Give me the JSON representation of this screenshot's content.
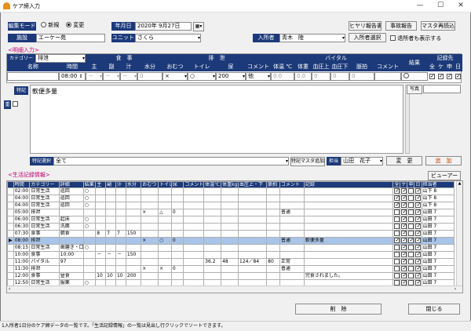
{
  "window": {
    "title": "ケア締入力",
    "min": "—",
    "max": "☐",
    "close": "✕"
  },
  "top": {
    "mode_label": "編集モード",
    "mode_new": "新規",
    "mode_edit": "変更",
    "date_label": "年月日",
    "date_value": "2020年 9月27日",
    "btn_hiyari": "ヒヤリ報告書",
    "btn_jiko": "事故報告",
    "btn_master": "マスタ再読込",
    "facility_label": "施設",
    "facility_value": "エーケー苑",
    "unit_label": "ユニット",
    "unit_value": "さくら",
    "resident_label": "入所者",
    "resident_value": "青木　陸",
    "btn_select": "入所者選択",
    "show_discharged": "退所者も表示する"
  },
  "detail": {
    "section_title": "<明細入力>",
    "category_label": "カテゴリー",
    "category_value": "排泄",
    "groups": {
      "meal": "食　事",
      "excretion": "排　泄",
      "vital": "バイタル",
      "result": "結果",
      "record": "記録先"
    },
    "cols": [
      "名称",
      "時間",
      "主",
      "副",
      "汁",
      "水分",
      "おむつ",
      "トイレ",
      "尿",
      "コメント",
      "体温 ℃",
      "体重",
      "血圧上",
      "血圧下",
      "脈拍",
      "コメント"
    ],
    "rec_cols": [
      "全",
      "ケ",
      "申",
      "日"
    ],
    "row": {
      "time": "08:00",
      "omutsu": "×",
      "toilet": "○",
      "urine": "200",
      "comment": "他",
      "temp": "0.0",
      "weight": "0.0",
      "bpu": "0",
      "bpl": "0",
      "pulse": "0"
    },
    "tokki_label": "特記",
    "tokki_text": "軟便多量",
    "photo_label": "写真",
    "priority_label": "重",
    "tokki_select_label": "特記選択",
    "tokki_select_value": "全て",
    "tokki_master": "特記マスタ追加",
    "tanto_label": "担当",
    "tanto_value": "山田　花子",
    "btn_change": "変　更",
    "btn_add": "追　加"
  },
  "life": {
    "section_title": "<生活記録情報>",
    "btn_viewer": "ビューアー",
    "headers": [
      "時間",
      "カテゴリー",
      "詳細",
      "結果",
      "主",
      "副",
      "汁",
      "水分",
      "おむつ",
      "トイレ",
      "尿",
      "コメント",
      "体温℃",
      "体重kg",
      "血圧上・下",
      "脈拍",
      "コメント",
      "記録",
      "全",
      "ケ",
      "申",
      "日",
      "担当者"
    ],
    "rows": [
      {
        "time": "02:00",
        "cat": "日常生活",
        "detail": "巡回",
        "res": "○",
        "main": "",
        "side": "",
        "soup": "",
        "water": "",
        "omutsu": "",
        "toilet": "",
        "urine": "",
        "cmt": "",
        "temp": "",
        "wt": "",
        "bp": "",
        "pulse": "",
        "cmt2": "",
        "rec": "",
        "c": [
          1,
          1,
          0,
          1
        ],
        "staff": "山下 8"
      },
      {
        "time": "04:00",
        "cat": "日常生活",
        "detail": "巡回",
        "res": "○",
        "main": "",
        "side": "",
        "soup": "",
        "water": "",
        "omutsu": "",
        "toilet": "",
        "urine": "",
        "cmt": "",
        "temp": "",
        "wt": "",
        "bp": "",
        "pulse": "",
        "cmt2": "",
        "rec": "",
        "c": [
          1,
          1,
          0,
          1
        ],
        "staff": "山下 8"
      },
      {
        "time": "04:00",
        "cat": "日常生活",
        "detail": "巡回",
        "res": "○",
        "main": "",
        "side": "",
        "soup": "",
        "water": "",
        "omutsu": "",
        "toilet": "",
        "urine": "",
        "cmt": "",
        "temp": "",
        "wt": "",
        "bp": "",
        "pulse": "",
        "cmt2": "",
        "rec": "",
        "c": [
          1,
          1,
          0,
          1
        ],
        "staff": "山下 8"
      },
      {
        "time": "05:00",
        "cat": "排泄",
        "detail": "",
        "res": "",
        "main": "",
        "side": "",
        "soup": "",
        "water": "",
        "omutsu": "×",
        "toilet": "△",
        "urine": "0",
        "cmt": "",
        "temp": "",
        "wt": "",
        "bp": "",
        "pulse": "",
        "cmt2": "普通",
        "rec": "",
        "c": [
          0,
          1,
          0,
          1
        ],
        "staff": "山田 7"
      },
      {
        "time": "06:00",
        "cat": "日常生活",
        "detail": "起床",
        "res": "○",
        "main": "",
        "side": "",
        "soup": "",
        "water": "",
        "omutsu": "",
        "toilet": "",
        "urine": "",
        "cmt": "",
        "temp": "",
        "wt": "",
        "bp": "",
        "pulse": "",
        "cmt2": "",
        "rec": "",
        "c": [
          0,
          1,
          0,
          1
        ],
        "staff": "山田 7"
      },
      {
        "time": "06:30",
        "cat": "日常生活",
        "detail": "洗面",
        "res": "○",
        "main": "",
        "side": "",
        "soup": "",
        "water": "",
        "omutsu": "",
        "toilet": "",
        "urine": "",
        "cmt": "",
        "temp": "",
        "wt": "",
        "bp": "",
        "pulse": "",
        "cmt2": "",
        "rec": "",
        "c": [
          0,
          1,
          0,
          1
        ],
        "staff": "山田 7"
      },
      {
        "time": "07:30",
        "cat": "食事",
        "detail": "朝食",
        "res": "",
        "main": "8",
        "side": "7",
        "soup": "7",
        "water": "150",
        "omutsu": "",
        "toilet": "",
        "urine": "",
        "cmt": "",
        "temp": "",
        "wt": "",
        "bp": "",
        "pulse": "",
        "cmt2": "",
        "rec": "",
        "c": [
          0,
          1,
          0,
          1
        ],
        "staff": "山田 7"
      },
      {
        "time": "08:00",
        "cat": "排泄",
        "detail": "",
        "res": "",
        "main": "",
        "side": "",
        "soup": "",
        "water": "",
        "omutsu": "×",
        "toilet": "○",
        "urine": "0",
        "cmt": "",
        "temp": "",
        "wt": "",
        "bp": "",
        "pulse": "",
        "cmt2": "普通",
        "rec": "軟便多量",
        "c": [
          1,
          1,
          1,
          1
        ],
        "staff": "山田 7",
        "sel": true
      },
      {
        "time": "08:15",
        "cat": "日常生活",
        "detail": "歯磨き・口",
        "res": "○",
        "main": "",
        "side": "",
        "soup": "",
        "water": "",
        "omutsu": "",
        "toilet": "",
        "urine": "",
        "cmt": "",
        "temp": "",
        "wt": "",
        "bp": "",
        "pulse": "",
        "cmt2": "",
        "rec": "",
        "c": [
          0,
          1,
          0,
          1
        ],
        "staff": "山田 7"
      },
      {
        "time": "10:00",
        "cat": "食事",
        "detail": "10:00",
        "res": "",
        "main": "－",
        "side": "－",
        "soup": "－",
        "water": "150",
        "omutsu": "",
        "toilet": "",
        "urine": "",
        "cmt": "",
        "temp": "",
        "wt": "",
        "bp": "",
        "pulse": "",
        "cmt2": "",
        "rec": "",
        "c": [
          0,
          1,
          0,
          1
        ],
        "staff": "山田 7"
      },
      {
        "time": "11:00",
        "cat": "バイタル",
        "detail": "97",
        "res": "",
        "main": "",
        "side": "",
        "soup": "",
        "water": "",
        "omutsu": "",
        "toilet": "",
        "urine": "",
        "cmt": "",
        "temp": "36.2",
        "wt": "48",
        "bp": "124／84",
        "pulse": "80",
        "cmt2": "正常",
        "rec": "",
        "c": [
          0,
          1,
          0,
          1
        ],
        "staff": "山田 7"
      },
      {
        "time": "11:30",
        "cat": "排泄",
        "detail": "",
        "res": "",
        "main": "",
        "side": "",
        "soup": "",
        "water": "",
        "omutsu": "×",
        "toilet": "×",
        "urine": "0",
        "cmt": "",
        "temp": "",
        "wt": "",
        "bp": "",
        "pulse": "",
        "cmt2": "普通",
        "rec": "",
        "c": [
          0,
          1,
          0,
          1
        ],
        "staff": "山田 7"
      },
      {
        "time": "12:00",
        "cat": "食事",
        "detail": "昼食",
        "res": "",
        "main": "10",
        "side": "10",
        "soup": "10",
        "water": "200",
        "omutsu": "",
        "toilet": "",
        "urine": "",
        "cmt": "",
        "temp": "",
        "wt": "",
        "bp": "",
        "pulse": "",
        "cmt2": "",
        "rec": "完食されました。",
        "c": [
          0,
          1,
          0,
          1
        ],
        "staff": "山田 7"
      },
      {
        "time": "12:50",
        "cat": "日常生活",
        "detail": "服薬",
        "res": "○",
        "main": "",
        "side": "",
        "soup": "",
        "water": "",
        "omutsu": "",
        "toilet": "",
        "urine": "",
        "cmt": "",
        "temp": "",
        "wt": "",
        "bp": "",
        "pulse": "",
        "cmt2": "",
        "rec": "",
        "c": [
          0,
          1,
          0,
          1
        ],
        "staff": "山田 7"
      }
    ],
    "btn_delete": "削　除",
    "btn_close": "閉じる"
  },
  "status": "1入所者1日分のケア締データの一覧です。「生活記録情報」の一覧は見出し行クリックでソートできます。"
}
